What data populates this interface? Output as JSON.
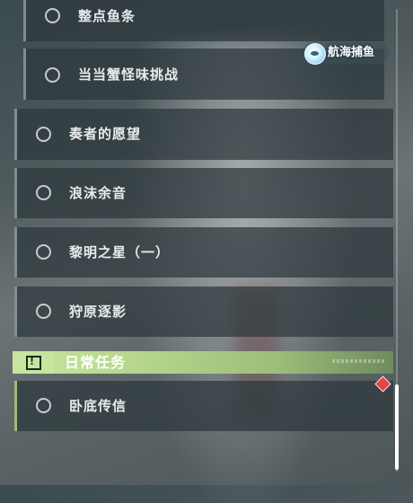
{
  "quests": {
    "sub_items": [
      {
        "label": "整点鱼条"
      },
      {
        "label": "当当蟹怪味挑战"
      }
    ],
    "items": [
      {
        "label": "奏者的愿望"
      },
      {
        "label": "浪沫余音"
      },
      {
        "label": "黎明之星（一）"
      },
      {
        "label": "狩原逐影"
      }
    ]
  },
  "section": {
    "title": "日常任务",
    "icon": "exclamation-box-icon",
    "accent": "#c7e59d"
  },
  "daily": {
    "items": [
      {
        "label": "卧底传信"
      }
    ]
  },
  "badge": {
    "label": "航海捕鱼",
    "icon": "fishing-icon"
  },
  "marker": {
    "icon": "tracking-diamond-icon",
    "color": "#e0464b"
  }
}
